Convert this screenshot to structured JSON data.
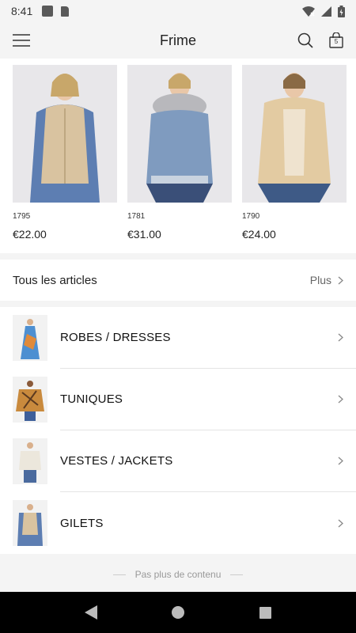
{
  "status_bar": {
    "time": "8:41"
  },
  "app_bar": {
    "title": "Frime",
    "cart_count": "5"
  },
  "products": [
    {
      "code": "1795",
      "price": "€22.00"
    },
    {
      "code": "1781",
      "price": "€31.00"
    },
    {
      "code": "1790",
      "price": "€24.00"
    }
  ],
  "all_articles": {
    "label": "Tous les articles",
    "more": "Plus"
  },
  "categories": [
    {
      "label": "ROBES / DRESSES"
    },
    {
      "label": "TUNIQUES"
    },
    {
      "label": "VESTES / JACKETS"
    },
    {
      "label": "GILETS"
    }
  ],
  "footer": {
    "note": "Pas plus de contenu"
  },
  "colors": {
    "accent": "#222222",
    "background": "#f4f4f4",
    "divider": "#e4e4e4"
  },
  "icons": [
    "menu-icon",
    "search-icon",
    "cart-icon",
    "chevron-right-icon",
    "back-icon",
    "home-icon",
    "recents-icon"
  ]
}
